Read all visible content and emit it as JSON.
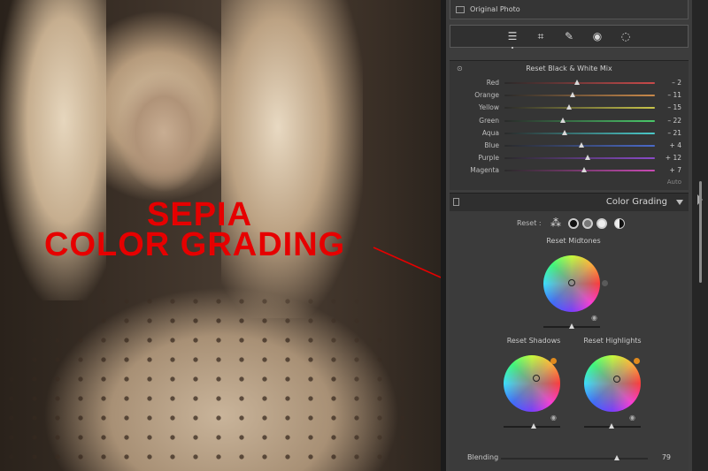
{
  "overlay": {
    "line1": "SEPIA",
    "line2": "COLOR GRADING",
    "color": "#e60000"
  },
  "original_photo": {
    "label": "Original Photo"
  },
  "tools": [
    {
      "name": "edit-sliders-icon",
      "glyph": "☰"
    },
    {
      "name": "crop-icon",
      "glyph": "⌗"
    },
    {
      "name": "healing-icon",
      "glyph": "✎"
    },
    {
      "name": "red-eye-icon",
      "glyph": "◉"
    },
    {
      "name": "masking-icon",
      "glyph": "◌"
    }
  ],
  "bw_mix": {
    "title": "Reset Black & White Mix",
    "auto_label": "Auto",
    "sliders": [
      {
        "label": "Red",
        "value": "– 2",
        "pos": 0.48,
        "color": "#c94a4a"
      },
      {
        "label": "Orange",
        "value": "– 11",
        "pos": 0.45,
        "color": "#c9894a"
      },
      {
        "label": "Yellow",
        "value": "– 15",
        "pos": 0.43,
        "color": "#c9c54a"
      },
      {
        "label": "Green",
        "value": "– 22",
        "pos": 0.39,
        "color": "#4ac96a"
      },
      {
        "label": "Aqua",
        "value": "– 21",
        "pos": 0.4,
        "color": "#4ac9c9"
      },
      {
        "label": "Blue",
        "value": "+ 4",
        "pos": 0.51,
        "color": "#4a6ac9"
      },
      {
        "label": "Purple",
        "value": "+ 12",
        "pos": 0.55,
        "color": "#8a4ac9"
      },
      {
        "label": "Magenta",
        "value": "+ 7",
        "pos": 0.53,
        "color": "#c94ab4"
      }
    ]
  },
  "color_grading": {
    "title": "Color Grading",
    "reset_label": "Reset :",
    "midtones_label": "Reset Midtones",
    "shadows_label": "Reset Shadows",
    "highlights_label": "Reset Highlights",
    "blending_label": "Blending",
    "blending_value": "79",
    "blending_pos": 0.79,
    "shadows_swatch": "#e08a1e",
    "highlights_swatch": "#e08a1e",
    "midtones_swatch": "#5a5a5a"
  }
}
